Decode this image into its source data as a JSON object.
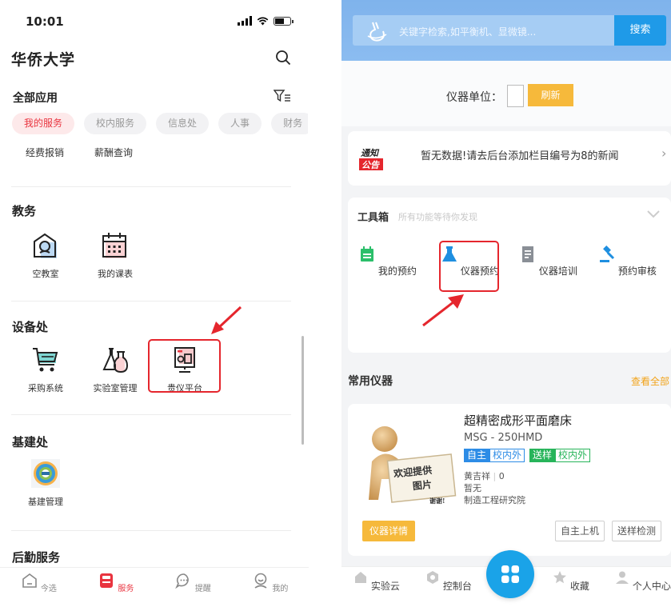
{
  "left_app": {
    "status_bar": {
      "time": "10:01"
    },
    "title": "华侨大学",
    "all_apps_label": "全部应用",
    "category_tabs": [
      {
        "label": "我的服务",
        "active": true
      },
      {
        "label": "校内服务",
        "active": false
      },
      {
        "label": "信息处",
        "active": false
      },
      {
        "label": "人事",
        "active": false
      },
      {
        "label": "财务",
        "active": false
      }
    ],
    "my_services": [
      "经费报销",
      "薪酬查询"
    ],
    "sections": {
      "jiaowu": {
        "title": "教务",
        "apps": [
          "空教室",
          "我的课表"
        ]
      },
      "shebei": {
        "title": "设备处",
        "apps": [
          "采购系统",
          "实验室管理",
          "贵仪平台"
        ]
      },
      "jijian": {
        "title": "基建处",
        "apps": [
          "基建管理"
        ]
      },
      "houqin": {
        "title": "后勤服务"
      }
    },
    "tabbar": [
      {
        "label": "今选",
        "active": false
      },
      {
        "label": "服务",
        "active": true
      },
      {
        "label": "提醒",
        "active": false
      },
      {
        "label": "我的",
        "active": false
      }
    ],
    "colors": {
      "accent_red": "#e9343f",
      "highlight_box": "#e5262d"
    }
  },
  "right_app": {
    "search": {
      "placeholder": "关键字检索,如平衡机、显微镜...",
      "button": "搜索"
    },
    "unit": {
      "label": "仪器单位：",
      "refresh_button": "刷新"
    },
    "notice": {
      "badge_line1": "通知",
      "badge_line2": "公告",
      "text": "暂无数据!请去后台添加栏目编号为8的新闻"
    },
    "toolbox": {
      "title": "工具箱",
      "subtitle": "所有功能等待你发现",
      "tools": [
        "我的预约",
        "仪器预约",
        "仪器培训",
        "预约审核"
      ]
    },
    "common": {
      "title": "常用仪器",
      "view_all": "查看全部"
    },
    "instrument": {
      "thumb_text_line1": "欢迎提供",
      "thumb_text_line2": "图片",
      "thumb_text_line3": "谢谢!",
      "name": "超精密成形平面磨床",
      "model": "MSG - 250HMD",
      "tags": [
        {
          "a": "自主",
          "b": "校内外"
        },
        {
          "a": "送样",
          "b": "校内外"
        }
      ],
      "person": "黄吉祥",
      "count": "0",
      "status": "暂无",
      "department": "制造工程研究院",
      "detail_button": "仪器详情",
      "self_button": "自主上机",
      "sample_button": "送样检测"
    },
    "nav": [
      "实验云",
      "控制台",
      "收藏",
      "个人中心"
    ],
    "colors": {
      "header_blue": "#8bbcf0",
      "search_btn": "#1f9ae8",
      "orange": "#f6b93b",
      "fab": "#1aa3e8"
    }
  }
}
